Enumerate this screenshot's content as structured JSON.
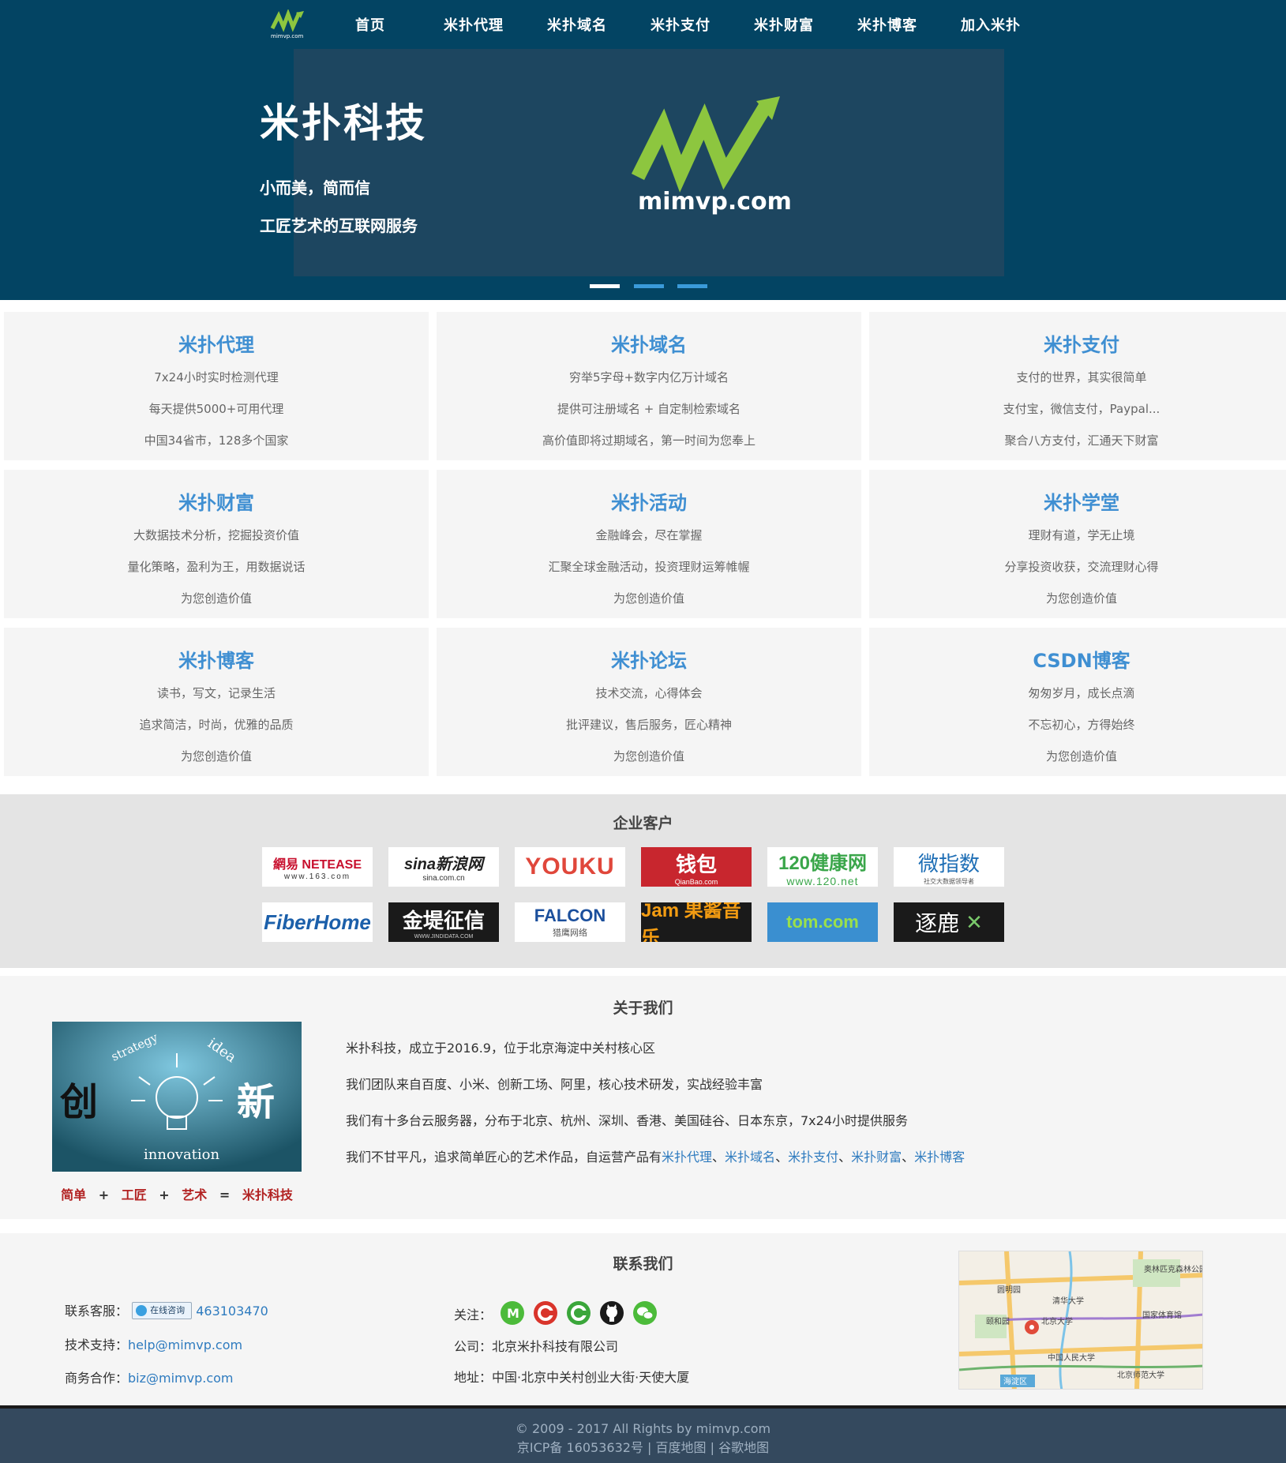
{
  "nav": {
    "items": [
      {
        "label": "首页"
      },
      {
        "label": "米扑代理"
      },
      {
        "label": "米扑域名"
      },
      {
        "label": "米扑支付"
      },
      {
        "label": "米扑财富"
      },
      {
        "label": "米扑博客"
      },
      {
        "label": "加入米扑"
      }
    ],
    "logo_text": "mimvp.com"
  },
  "hero": {
    "title": "米扑科技",
    "subtitle1": "小而美，简而信",
    "subtitle2": "工匠艺术的互联网服务",
    "logo_text": "mimvp.com",
    "slides": 3,
    "active_slide": 1
  },
  "cards": [
    {
      "title": "米扑代理",
      "lines": [
        "7x24小时实时检测代理",
        "每天提供5000+可用代理",
        "中国34省市，128多个国家"
      ]
    },
    {
      "title": "米扑域名",
      "lines": [
        "穷举5字母+数字内亿万计域名",
        "提供可注册域名 + 自定制检索域名",
        "高价值即将过期域名，第一时间为您奉上"
      ]
    },
    {
      "title": "米扑支付",
      "lines": [
        "支付的世界，其实很简单",
        "支付宝，微信支付，Paypal...",
        "聚合八方支付，汇通天下财富"
      ]
    },
    {
      "title": "米扑财富",
      "lines": [
        "大数据技术分析，挖掘投资价值",
        "量化策略，盈利为王，用数据说话",
        "为您创造价值"
      ]
    },
    {
      "title": "米扑活动",
      "lines": [
        "金融峰会，尽在掌握",
        "汇聚全球金融活动，投资理财运筹帷幄",
        "为您创造价值"
      ]
    },
    {
      "title": "米扑学堂",
      "lines": [
        "理财有道，学无止境",
        "分享投资收获，交流理财心得",
        "为您创造价值"
      ]
    },
    {
      "title": "米扑博客",
      "lines": [
        "读书，写文，记录生活",
        "追求简洁，时尚，优雅的品质",
        "为您创造价值"
      ]
    },
    {
      "title": "米扑论坛",
      "lines": [
        "技术交流，心得体会",
        "批评建议，售后服务，匠心精神",
        "为您创造价值"
      ]
    },
    {
      "title": "CSDN博客",
      "lines": [
        "匆匆岁月，成长点滴",
        "不忘初心，方得始终",
        "为您创造价值"
      ]
    }
  ],
  "clients": {
    "title": "企业客户",
    "logos": [
      {
        "name": "網易 NETEASE",
        "sub": "www.163.com"
      },
      {
        "name": "sina新浪网",
        "sub": "sina.com.cn"
      },
      {
        "name": "YOUKU",
        "sub": ""
      },
      {
        "name": "钱包",
        "sub": "QianBao.com"
      },
      {
        "name": "120健康网",
        "sub": "www.120.net"
      },
      {
        "name": "微指数",
        "sub": "社交大数据领导者"
      },
      {
        "name": "FiberHome",
        "sub": ""
      },
      {
        "name": "金堤征信",
        "sub": "WWW.JINDIDATA.COM"
      },
      {
        "name": "FALCON",
        "sub": "猎鹰网络"
      },
      {
        "name": "Jam 果酱音乐",
        "sub": ""
      },
      {
        "name": "tom.com",
        "sub": ""
      },
      {
        "name": "逐鹿",
        "sub": ""
      }
    ]
  },
  "about": {
    "title": "关于我们",
    "image_words": {
      "left": "创",
      "right": "新",
      "top1": "strategy",
      "top2": "idea",
      "bottom": "innovation"
    },
    "formula": {
      "a": "简单",
      "b": "工匠",
      "c": "艺术",
      "result": "米扑科技",
      "plus": "+",
      "eq": "="
    },
    "line1": "米扑科技，成立于2016.9，位于北京海淀中关村核心区",
    "line2": "我们团队来自百度、小米、创新工场、阿里，核心技术研发，实战经验丰富",
    "line3": "我们有十多台云服务器，分布于北京、杭州、深圳、香港、美国硅谷、日本东京，7x24小时提供服务",
    "line4_prefix": "我们不甘平凡，追求简单匠心的艺术作品，自运营产品有",
    "products": [
      "米扑代理",
      "米扑域名",
      "米扑支付",
      "米扑财富",
      "米扑博客"
    ],
    "sep": "、"
  },
  "contact": {
    "title": "联系我们",
    "service_label": "联系客服：",
    "qq_badge": "在线咨询",
    "qq": "463103470",
    "tech_label": "技术支持：",
    "tech_email": "help@mimvp.com",
    "biz_label": "商务合作：",
    "biz_email": "biz@mimvp.com",
    "follow_label": "关注：",
    "social_icons": [
      {
        "icon": "mimvp-icon",
        "color": "#4cbb3a"
      },
      {
        "icon": "csdn-icon",
        "color": "#d9342b"
      },
      {
        "icon": "c-icon",
        "color": "#3aa63a"
      },
      {
        "icon": "github-icon",
        "color": "#1a1a1a"
      },
      {
        "icon": "wechat-icon",
        "color": "#4cbb3a"
      }
    ],
    "company_label": "公司：",
    "company": "北京米扑科技有限公司",
    "address_label": "地址：",
    "address": "中国·北京中关村创业大街·天使大厦",
    "map_labels": [
      "奥林匹克森林公园",
      "圆明园",
      "清华大学",
      "颐和园",
      "北京大学",
      "国家体育馆",
      "中国人民大学",
      "海淀区",
      "北京师范大学"
    ]
  },
  "footer": {
    "copyright": "© 2009 - 2017 All Rights by mimvp.com",
    "icp": "京ICP备 16053632号",
    "sep": "|",
    "baidu_map": "百度地图",
    "google_map": "谷歌地图"
  },
  "colors": {
    "hero_bg": "#034463",
    "accent_blue": "#3f8fd2",
    "logo_green": "#8dc63f",
    "footer_bg": "#34495e",
    "red": "#b22222"
  }
}
